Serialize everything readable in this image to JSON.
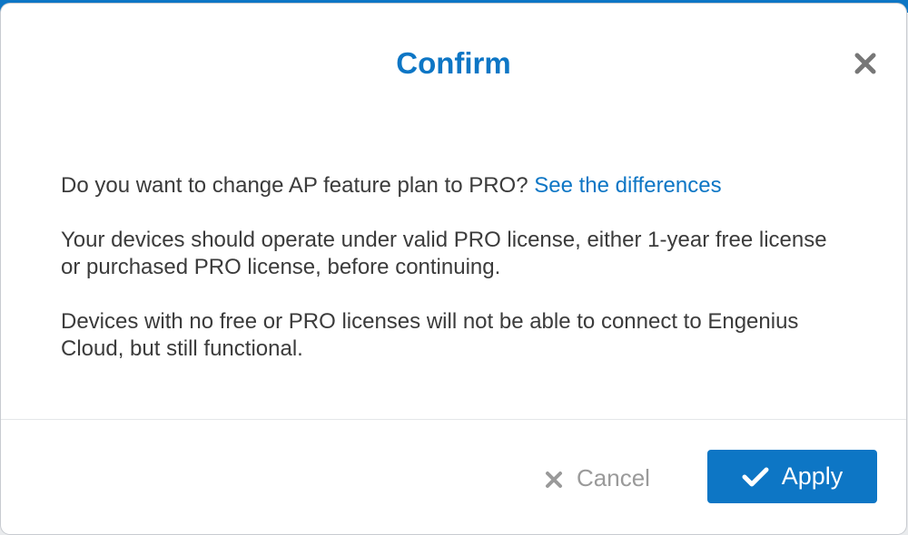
{
  "dialog": {
    "title": "Confirm",
    "body": {
      "question": "Do you want to change AP feature plan to PRO?",
      "link_text": "See the differences",
      "paragraph2": "Your devices should operate under valid PRO license, either 1-year free license or purchased PRO license, before continuing.",
      "paragraph3": "Devices with no free or PRO licenses will not be able to connect to Engenius Cloud, but still functional."
    },
    "buttons": {
      "cancel_label": "Cancel",
      "apply_label": "Apply"
    },
    "colors": {
      "accent": "#0d76c5",
      "text": "#3b3b3b",
      "muted": "#9a9a9a"
    },
    "icons": {
      "close": "close-icon",
      "cancel": "close-icon",
      "apply": "checkmark-icon"
    }
  }
}
